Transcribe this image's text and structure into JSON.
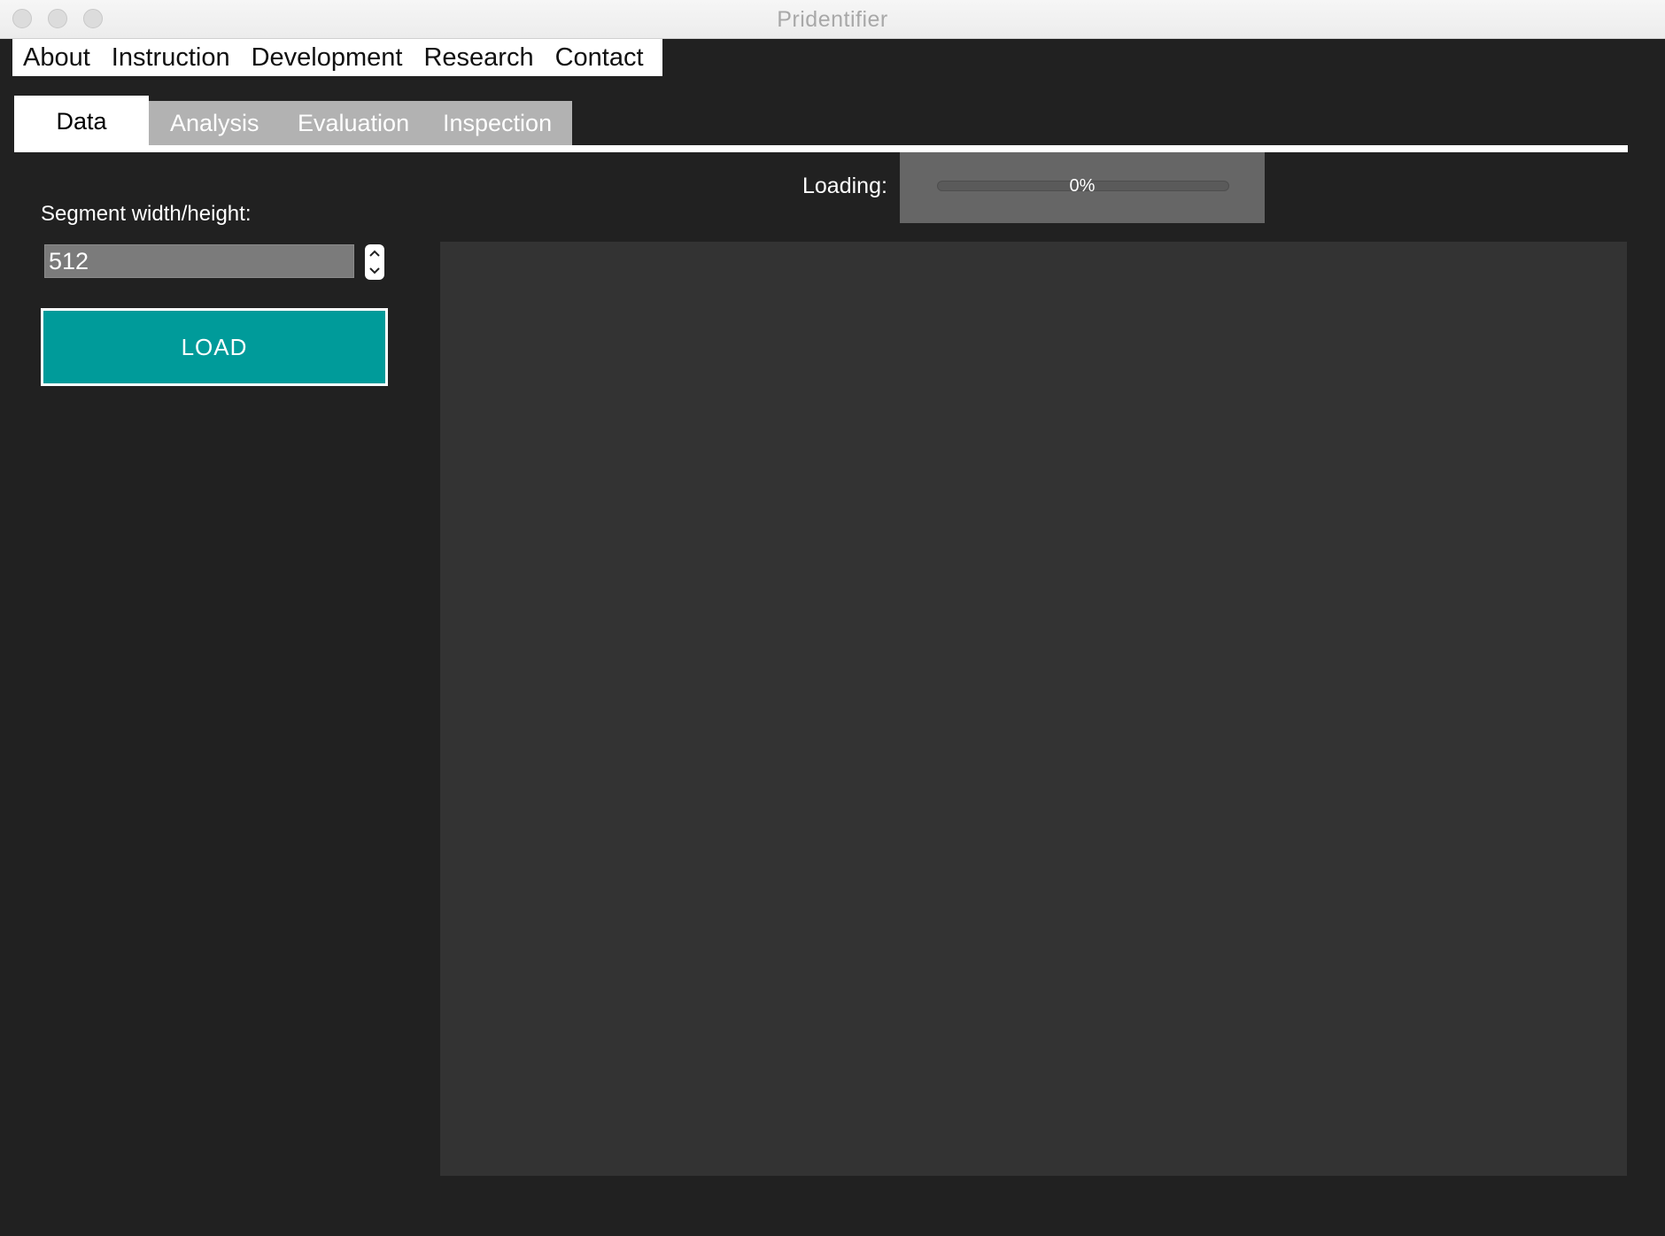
{
  "window": {
    "title": "Pridentifier"
  },
  "menu": {
    "items": [
      {
        "label": "About"
      },
      {
        "label": "Instruction"
      },
      {
        "label": "Development"
      },
      {
        "label": "Research"
      },
      {
        "label": "Contact"
      }
    ]
  },
  "tabs": {
    "active": "Data",
    "items": [
      {
        "label": "Data"
      },
      {
        "label": "Analysis"
      },
      {
        "label": "Evaluation"
      },
      {
        "label": "Inspection"
      }
    ]
  },
  "loading": {
    "label": "Loading:",
    "progress_percent": 0,
    "progress_text": "0%"
  },
  "segment": {
    "label": "Segment width/height:",
    "value": "512"
  },
  "load_button": {
    "label": "LOAD"
  },
  "icons": {
    "stepper_up": "chevron-up-icon",
    "stepper_down": "chevron-down-icon"
  },
  "colors": {
    "background": "#212121",
    "accent": "#009b9a",
    "panel": "#333333",
    "tab_inactive": "#b2b2b2"
  }
}
